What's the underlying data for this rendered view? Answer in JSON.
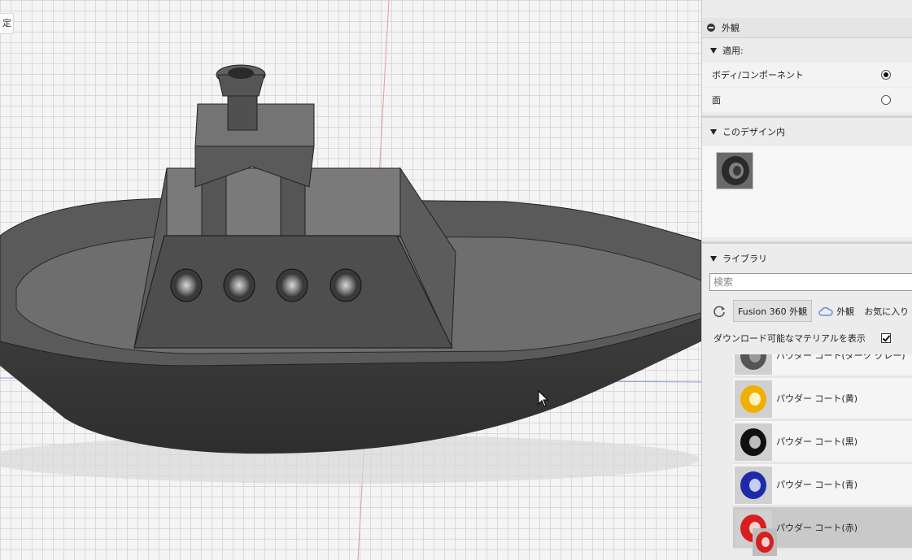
{
  "viewport": {
    "corner_label": "定"
  },
  "panel": {
    "title": "外観",
    "apply_section": {
      "title": "適用:",
      "options": [
        {
          "label": "ボディ/コンポーネント",
          "selected": true
        },
        {
          "label": "面",
          "selected": false
        }
      ]
    },
    "design_section": {
      "title": "このデザイン内"
    },
    "library_section": {
      "title": "ライブラリ",
      "search_placeholder": "検索",
      "tabs": {
        "fusion": "Fusion 360 外観",
        "cloud": "外観",
        "favorites": "お気に入り"
      },
      "show_downloadable": "ダウンロード可能なマテリアルを表示",
      "show_downloadable_checked": true,
      "materials": [
        {
          "name": "パウダー コート(ダーク グレー)",
          "color": "#555555"
        },
        {
          "name": "パウダー コート(黄)",
          "color": "#f0b000"
        },
        {
          "name": "パウダー コート(黒)",
          "color": "#111111"
        },
        {
          "name": "パウダー コート(青)",
          "color": "#1f2aa8"
        },
        {
          "name": "パウダー コート(赤)",
          "color": "#d81e1e",
          "selected": true
        }
      ]
    }
  }
}
